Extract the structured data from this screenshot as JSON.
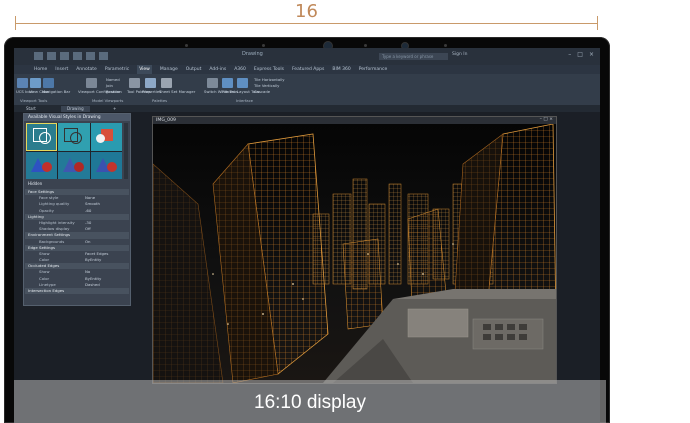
{
  "dimension": {
    "label": "16"
  },
  "app": {
    "title": "Drawing",
    "search_placeholder": "Type a keyword or phrase",
    "sign_in": "Sign In"
  },
  "ribbon_tabs": [
    "Home",
    "Insert",
    "Annotate",
    "Parametric",
    "View",
    "Manage",
    "Output",
    "Add-ins",
    "A360",
    "Express Tools",
    "Featured Apps",
    "BIM 360",
    "Performance"
  ],
  "ribbon_active_tab": "View",
  "ribbon": {
    "groups": [
      {
        "title": "Viewport Tools",
        "buttons": [
          "UCS Icon",
          "View Cube",
          "Navigation Bar"
        ]
      },
      {
        "title": "Model Viewports",
        "buttons": [
          "Viewport Configuration",
          "Named",
          "Join",
          "Restore"
        ]
      },
      {
        "title": "Palettes",
        "buttons": [
          "Tool Palettes",
          "Properties",
          "Sheet Set Manager"
        ]
      },
      {
        "title": "Interface",
        "buttons": [
          "Switch Windows",
          "File Tabs",
          "Layout Tabs",
          "Tile Horizontally",
          "Tile Vertically",
          "Cascade"
        ]
      }
    ]
  },
  "doc_tabs": [
    "Start",
    "Drawing"
  ],
  "palette": {
    "header": "Available Visual Styles in Drawing",
    "selected_style": "Hidden",
    "rows": [
      {
        "type": "section",
        "label": "Face Settings"
      },
      {
        "type": "prop",
        "key": "Face style",
        "value": "None"
      },
      {
        "type": "prop",
        "key": "Lighting quality",
        "value": "Smooth"
      },
      {
        "type": "prop",
        "key": "Opacity",
        "value": "-60"
      },
      {
        "type": "section",
        "label": "Lighting"
      },
      {
        "type": "prop",
        "key": "Highlight intensity",
        "value": "-30"
      },
      {
        "type": "prop",
        "key": "Shadow display",
        "value": "Off"
      },
      {
        "type": "section",
        "label": "Environment Settings"
      },
      {
        "type": "prop",
        "key": "Backgrounds",
        "value": "On"
      },
      {
        "type": "section",
        "label": "Edge Settings"
      },
      {
        "type": "prop",
        "key": "Show",
        "value": "Facet Edges"
      },
      {
        "type": "prop",
        "key": "Color",
        "value": "ByEntity"
      },
      {
        "type": "section",
        "label": "Occluded Edges"
      },
      {
        "type": "prop",
        "key": "Show",
        "value": "No"
      },
      {
        "type": "prop",
        "key": "Color",
        "value": "ByEntity"
      },
      {
        "type": "prop",
        "key": "Linetype",
        "value": "Dashed"
      },
      {
        "type": "section",
        "label": "Intersection Edges"
      }
    ]
  },
  "viewport": {
    "title": "IMG_009"
  },
  "caption": {
    "text": "16:10 display"
  },
  "colors": {
    "dimension": "#c99a6a",
    "ribbon_bg": "#333d4a",
    "city_accent": "#d08a30"
  }
}
